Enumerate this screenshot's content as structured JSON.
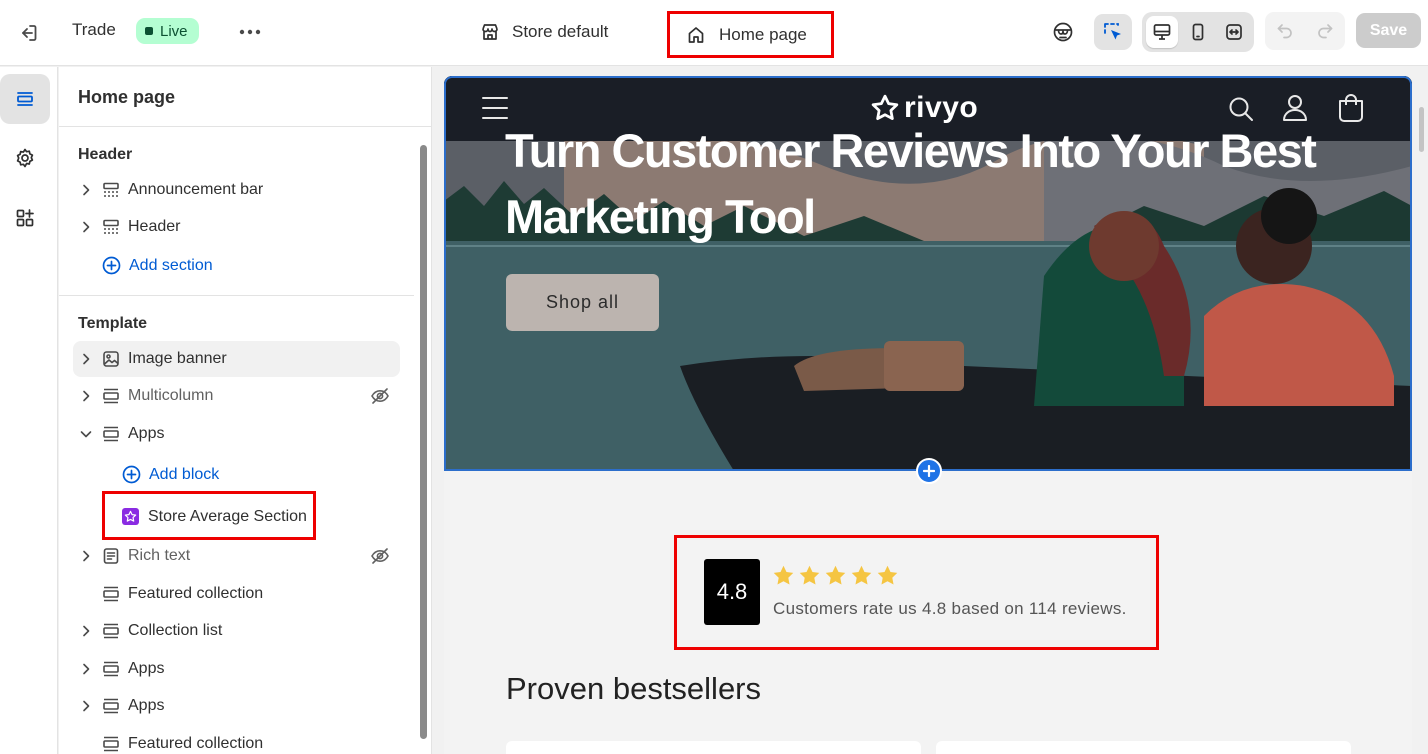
{
  "topbar": {
    "theme_name": "Trade",
    "live_badge": "Live",
    "store_label": "Store default",
    "page_label": "Home page",
    "save_label": "Save"
  },
  "sidebar": {
    "title": "Home page",
    "header_group": {
      "title": "Header",
      "items": [
        {
          "label": "Announcement bar"
        },
        {
          "label": "Header"
        }
      ],
      "add_section": "Add section"
    },
    "template_group": {
      "title": "Template",
      "items": [
        {
          "label": "Image banner"
        },
        {
          "label": "Multicolumn"
        },
        {
          "label": "Apps"
        },
        {
          "label": "Rich text"
        },
        {
          "label": "Featured collection"
        },
        {
          "label": "Collection list"
        },
        {
          "label": "Apps"
        },
        {
          "label": "Apps"
        },
        {
          "label": "Featured collection"
        }
      ],
      "add_block": "Add block",
      "app_block": "Store Average Section"
    }
  },
  "preview": {
    "logo_text": "rivyo",
    "hero_title": "Turn Customer Reviews Into Your Best Marketing Tool",
    "hero_button": "Shop all",
    "rating_value": "4.8",
    "rating_stars": 5,
    "rating_text": "Customers rate us 4.8 based on 114 reviews.",
    "section_title": "Proven bestsellers"
  },
  "colors": {
    "live_bg": "#b4fed2",
    "link": "#005bd3",
    "highlight": "#ee0000",
    "star": "#f5c542",
    "selection": "#2c6ecb"
  }
}
